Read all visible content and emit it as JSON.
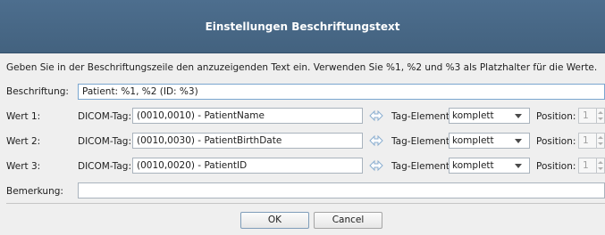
{
  "dialog": {
    "title": "Einstellungen Beschriftungstext",
    "instructions": "Geben Sie in der Beschriftungszeile den anzuzeigenden Text ein. Verwenden Sie %1, %2 und %3 als Platzhalter für die Werte.",
    "caption": {
      "label": "Beschriftung:",
      "value": "Patient: %1, %2 (ID: %3)"
    },
    "rows": [
      {
        "label": "Wert 1:",
        "tag_label": "DICOM-Tag:",
        "tag_value": "(0010,0010) - PatientName",
        "element_label": "Tag-Element:",
        "element_value": "komplett",
        "position_label": "Position:",
        "position_value": "1"
      },
      {
        "label": "Wert 2:",
        "tag_label": "DICOM-Tag:",
        "tag_value": "(0010,0030) - PatientBirthDate",
        "element_label": "Tag-Element:",
        "element_value": "komplett",
        "position_label": "Position:",
        "position_value": "1"
      },
      {
        "label": "Wert 3:",
        "tag_label": "DICOM-Tag:",
        "tag_value": "(0010,0020) - PatientID",
        "element_label": "Tag-Element:",
        "element_value": "komplett",
        "position_label": "Position:",
        "position_value": "1"
      }
    ],
    "remark": {
      "label": "Bemerkung:",
      "value": ""
    },
    "buttons": {
      "ok": "OK",
      "cancel": "Cancel"
    }
  },
  "colors": {
    "titlebar": "#4a6a8a",
    "background": "#efefef",
    "swap_icon": "#8aaed0"
  },
  "icons": {
    "swap": "swap-arrows-icon",
    "dropdown": "chevron-down-icon"
  }
}
